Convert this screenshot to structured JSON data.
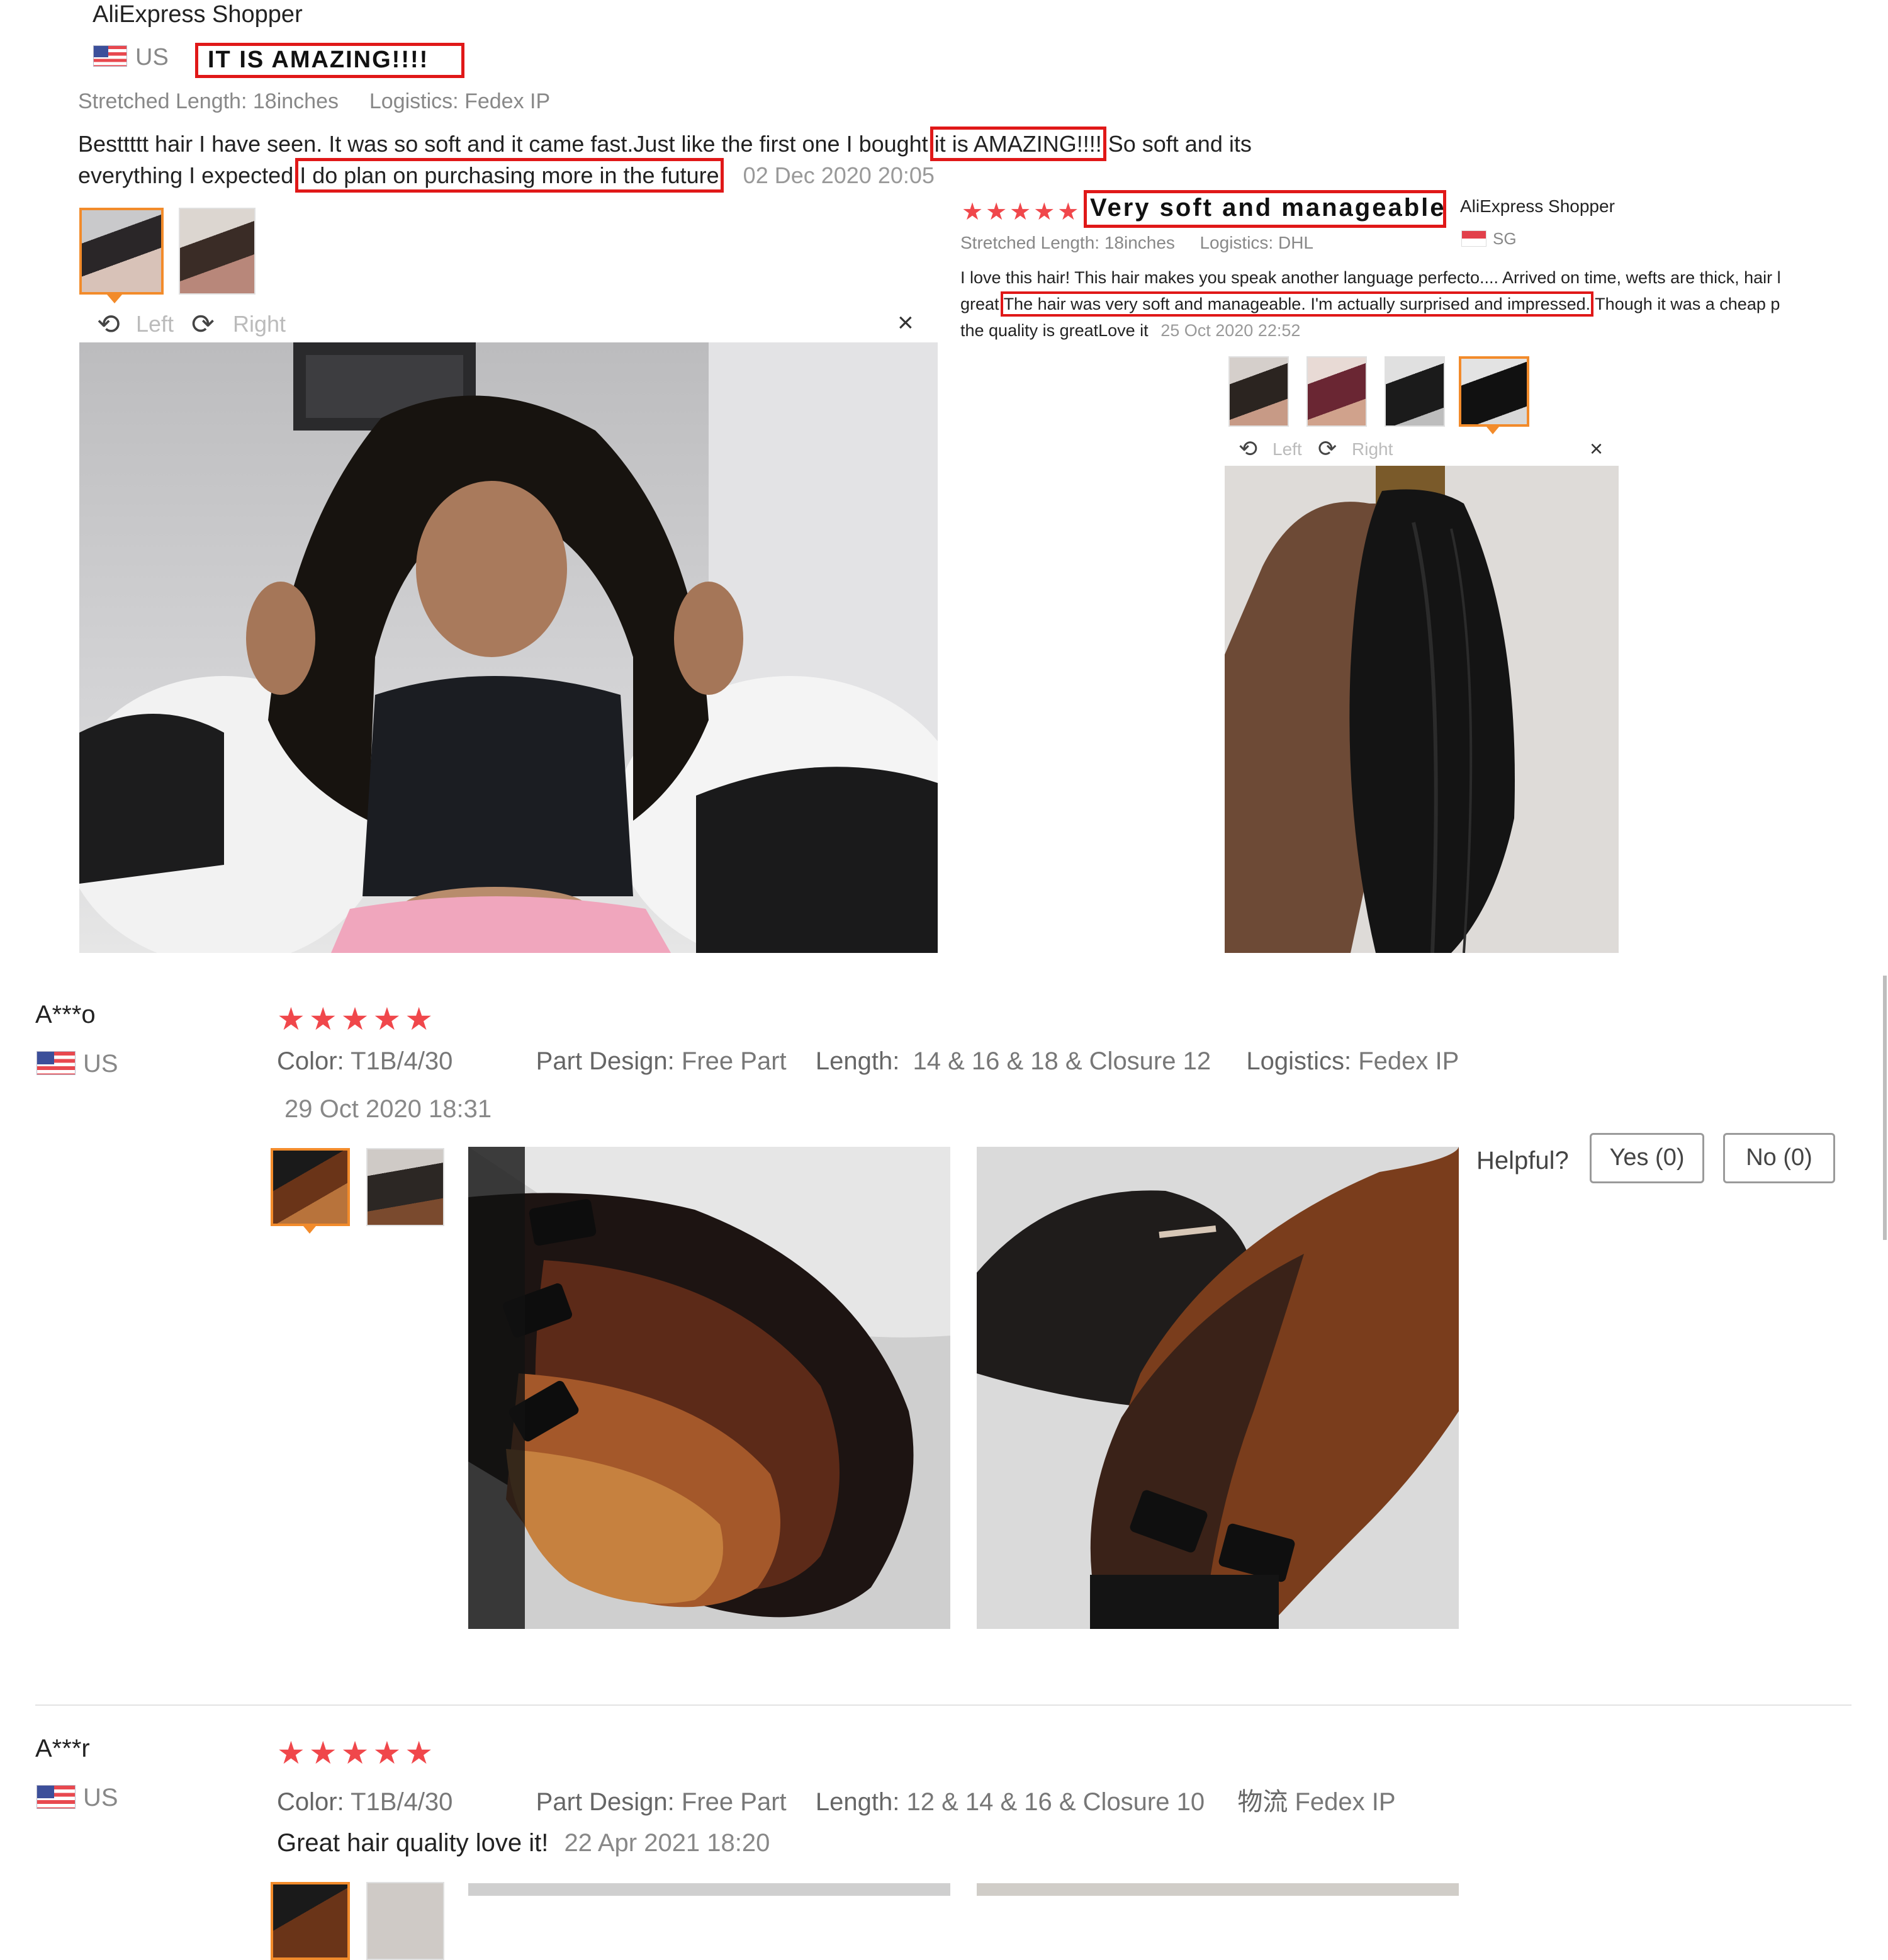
{
  "review1": {
    "author": "AliExpress Shopper",
    "country": "US",
    "headline": "IT IS AMAZING!!!!",
    "stretched_label": "Stretched Length:",
    "stretched_value": "18inches",
    "logistics_label": "Logistics:",
    "logistics_value": "Fedex IP",
    "text_line1_a": "Besttttt hair I have seen. It was so soft and it came fast.Just like the first one I bought ",
    "text_line1_hl": "it is AMAZING!!!!",
    "text_line1_b": " So soft and its",
    "text_line2_a": "everything I expected.",
    "text_line2_hl": "I do plan on purchasing more in the future",
    "text_line2_b": ".",
    "date": "02 Dec 2020 20:05",
    "viewer": {
      "left": "Left",
      "right": "Right",
      "close": "×"
    }
  },
  "review2": {
    "rating": "★★★★★",
    "headline": "Very soft and manageable",
    "author": "AliExpress Shopper",
    "country": "SG",
    "stretched_label": "Stretched Length:",
    "stretched_value": "18inches",
    "logistics_label": "Logistics:",
    "logistics_value": "DHL",
    "text_line1": "I love this hair! This hair makes you speak another language perfecto.... Arrived on time, wefts are thick, hair l",
    "text_line2_a": "great ",
    "text_line2_hl": "The hair was very soft and manageable. I'm actually surprised and impressed.",
    "text_line2_b": " Though it was a cheap p",
    "text_line3": "the quality is greatLove it",
    "date": "25 Oct 2020 22:52",
    "viewer": {
      "left": "Left",
      "right": "Right",
      "close": "×"
    }
  },
  "review3": {
    "author": "A***o",
    "country": "US",
    "rating": "★★★★★",
    "color_label": "Color:",
    "color_value": "T1B/4/30",
    "part_label": "Part Design:",
    "part_value": "Free Part",
    "length_label": "Length:",
    "length_value": "14 & 16 & 18 & Closure 12",
    "logistics_label": "Logistics:",
    "logistics_value": "Fedex IP",
    "date": "29 Oct 2020 18:31",
    "helpful_label": "Helpful?",
    "yes_label": "Yes (0)",
    "no_label": "No (0)"
  },
  "review4": {
    "author": "A***r",
    "country": "US",
    "rating": "★★★★★",
    "color_label": "Color:",
    "color_value": "T1B/4/30",
    "part_label": "Part Design:",
    "part_value": "Free Part",
    "length_label": "Length:",
    "length_value": "12 & 14 & 16  & Closure 10",
    "logistics_label": "物流",
    "logistics_value": "Fedex IP",
    "text": "Great hair quality love it!",
    "date": "22 Apr 2021 18:20"
  },
  "colors": {
    "star": "#f0474b",
    "highlight_border": "#e01818",
    "selected_thumb": "#f28b2b"
  }
}
